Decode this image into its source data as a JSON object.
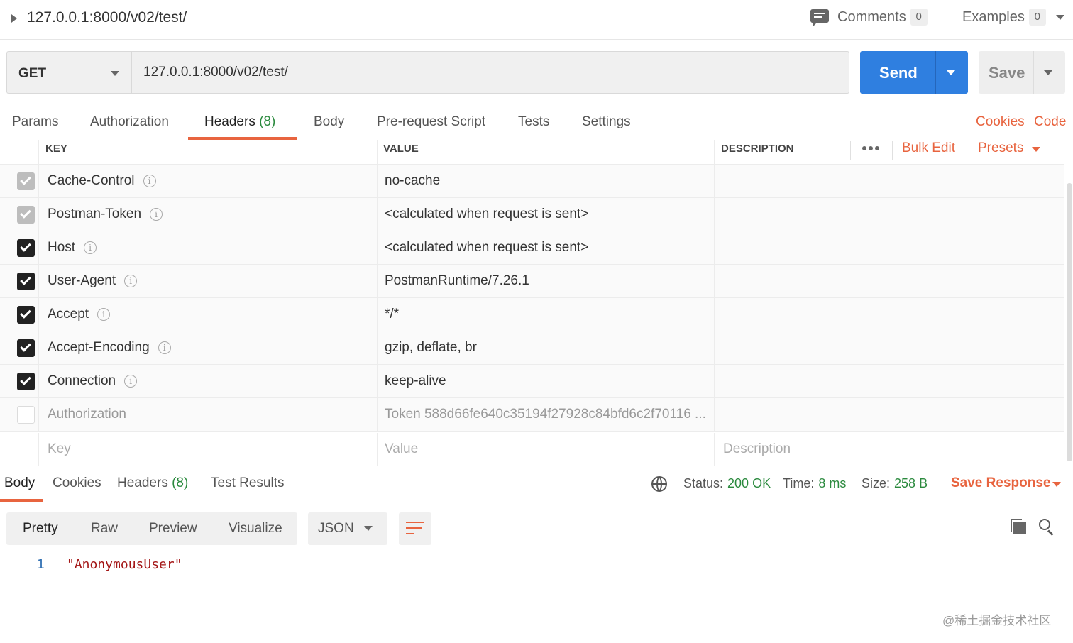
{
  "topbar": {
    "request_name": "127.0.0.1:8000/v02/test/",
    "comments_label": "Comments",
    "comments_count": "0",
    "examples_label": "Examples",
    "examples_count": "0"
  },
  "request": {
    "method": "GET",
    "url": "127.0.0.1:8000/v02/test/",
    "send_label": "Send",
    "save_label": "Save"
  },
  "request_tabs": [
    {
      "label": "Params"
    },
    {
      "label": "Authorization"
    },
    {
      "label": "Headers",
      "count": "(8)",
      "active": true
    },
    {
      "label": "Body"
    },
    {
      "label": "Pre-request Script"
    },
    {
      "label": "Tests"
    },
    {
      "label": "Settings"
    }
  ],
  "request_links": {
    "cookies": "Cookies",
    "code": "Code"
  },
  "headers_table": {
    "columns": {
      "key": "KEY",
      "value": "VALUE",
      "description": "DESCRIPTION"
    },
    "bulk_edit": "Bulk Edit",
    "presets": "Presets",
    "rows": [
      {
        "key": "Cache-Control",
        "value": "no-cache",
        "state": "grey"
      },
      {
        "key": "Postman-Token",
        "value": "<calculated when request is sent>",
        "state": "grey"
      },
      {
        "key": "Host",
        "value": "<calculated when request is sent>",
        "state": "on"
      },
      {
        "key": "User-Agent",
        "value": "PostmanRuntime/7.26.1",
        "state": "on"
      },
      {
        "key": "Accept",
        "value": "*/*",
        "state": "on"
      },
      {
        "key": "Accept-Encoding",
        "value": "gzip, deflate, br",
        "state": "on"
      },
      {
        "key": "Connection",
        "value": "keep-alive",
        "state": "on"
      },
      {
        "key": "Authorization",
        "value": "Token 588d66fe640c35194f27928c84bfd6c2f70116 ...",
        "state": "off"
      }
    ],
    "placeholders": {
      "key": "Key",
      "value": "Value",
      "description": "Description"
    }
  },
  "response": {
    "tabs": [
      {
        "label": "Body",
        "active": true
      },
      {
        "label": "Cookies"
      },
      {
        "label": "Headers",
        "count": "(8)"
      },
      {
        "label": "Test Results"
      }
    ],
    "status_label": "Status:",
    "status_value": "200 OK",
    "time_label": "Time:",
    "time_value": "8 ms",
    "size_label": "Size:",
    "size_value": "258 B",
    "save_response": "Save Response",
    "formats": [
      "Pretty",
      "Raw",
      "Preview",
      "Visualize"
    ],
    "language": "JSON",
    "code_lines": [
      {
        "no": "1",
        "text": "\"AnonymousUser\""
      }
    ]
  },
  "watermark": "@稀土掘金技术社区",
  "colors": {
    "accent": "#e8643f",
    "send_blue": "#2f7fe0",
    "success_green": "#2b8a3e"
  }
}
